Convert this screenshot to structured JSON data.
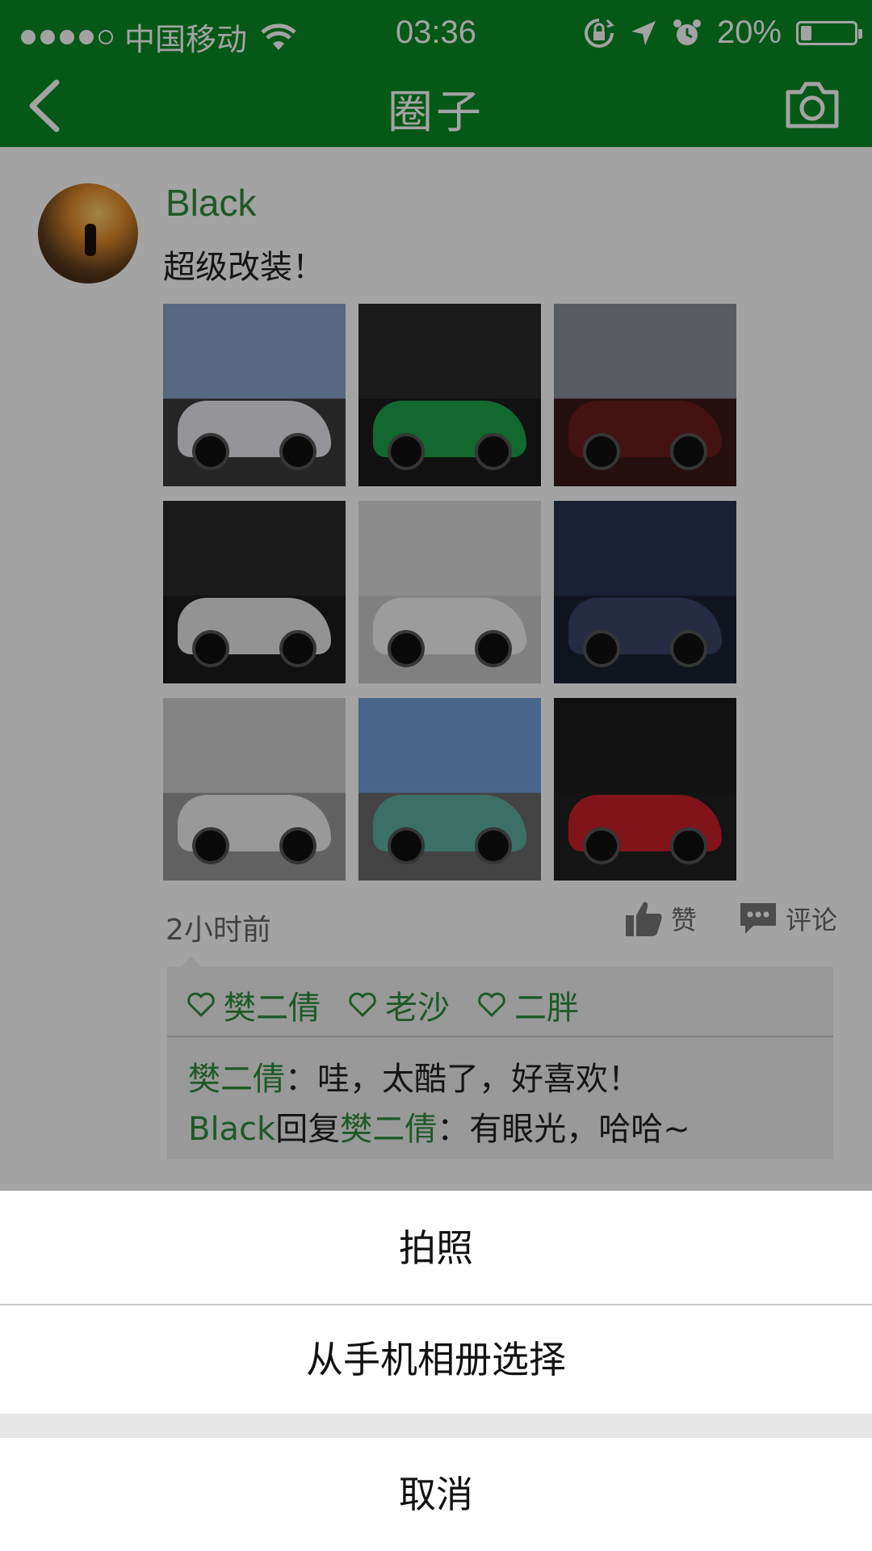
{
  "status_bar": {
    "carrier": "中国移动",
    "time": "03:36",
    "battery_text": "20%",
    "battery_level": 0.2,
    "signal_bars": 4
  },
  "nav": {
    "title": "圈子",
    "back_icon": "chevron-left-icon",
    "camera_icon": "camera-icon"
  },
  "post": {
    "username": "Black",
    "text": "超级改装！",
    "photos": [
      {
        "label": "white lamborghini",
        "sky": "#8aa3c9",
        "ground": "#3a3a3a",
        "body": "#e8e8f0"
      },
      {
        "label": "green supercar",
        "sky": "#2a2a2a",
        "ground": "#1c1c1c",
        "body": "#1fa34a"
      },
      {
        "label": "spiderman car",
        "sky": "#8a8f9a",
        "ground": "#3a1818",
        "body": "#6b1d1d"
      },
      {
        "label": "pagani zonda",
        "sky": "#2b2b2b",
        "ground": "#1c1c1c",
        "body": "#e6e6e6"
      },
      {
        "label": "white porsche",
        "sky": "#dcdcdc",
        "ground": "#c8c8c8",
        "body": "#f4f4f4"
      },
      {
        "label": "bmw race car",
        "sky": "#2a3550",
        "ground": "#1a2030",
        "body": "#3a4668"
      },
      {
        "label": "white ferrari",
        "sky": "#cfcfcf",
        "ground": "#9a9a9a",
        "body": "#f0f0f0"
      },
      {
        "label": "painted sedan",
        "sky": "#6fa0d8",
        "ground": "#6a6a6a",
        "body": "#5fb0a0"
      },
      {
        "label": "red evo",
        "sky": "#1a1a1a",
        "ground": "#202020",
        "body": "#c8202a"
      }
    ],
    "time": "2小时前",
    "like_label": "赞",
    "comment_label": "评论",
    "likes": [
      "樊二倩",
      "老沙",
      "二胖"
    ],
    "comments": [
      {
        "author": "樊二倩",
        "sep": "：",
        "text": "哇，太酷了，好喜欢！"
      },
      {
        "author": "Black",
        "reply_word": "回复",
        "target": "樊二倩",
        "sep": "：",
        "text": "有眼光，哈哈~"
      }
    ]
  },
  "action_sheet": {
    "take_photo": "拍照",
    "choose_album": "从手机相册选择",
    "cancel": "取消"
  },
  "colors": {
    "brand_green": "#0a8a24",
    "name_green": "#2e8b3d"
  }
}
